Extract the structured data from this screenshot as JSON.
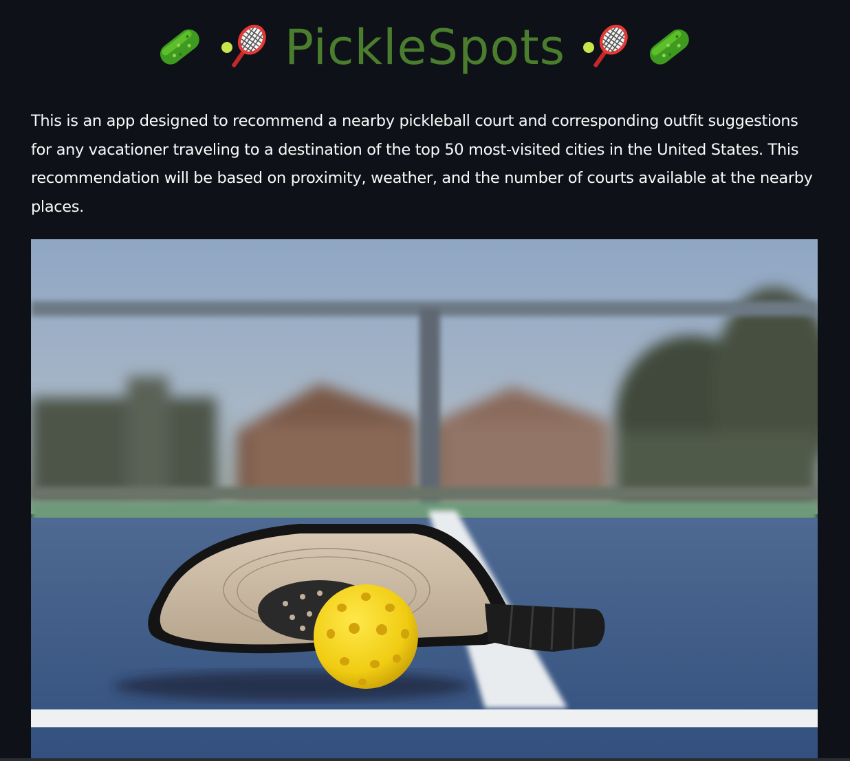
{
  "header": {
    "title": "PickleSpots",
    "icons": [
      "pickle-icon",
      "racket-ball-icon",
      "racket-ball-icon",
      "pickle-icon"
    ]
  },
  "intro": {
    "text": "This is an app designed to recommend a nearby pickleball court and corresponding outfit suggestions for any vacationer traveling to a destination of the top 50 most-visited cities in the United States. This recommendation will be based on proximity, weather, and the number of courts available at the nearby places."
  },
  "hero": {
    "subject": "pickleball-paddle-and-ball-photo"
  },
  "colors": {
    "background": "#0e1117",
    "title": "#4a7d2e",
    "text": "#fafafa",
    "court_blue": "#3d5a86",
    "ball_yellow": "#f2d21a"
  }
}
